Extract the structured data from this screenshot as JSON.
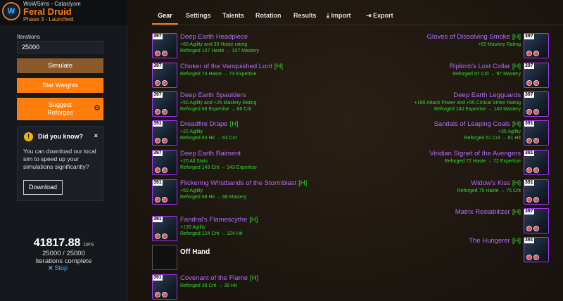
{
  "app": {
    "name": "WoWSims - Cataclysm",
    "spec": "Feral Druid",
    "phase": "Phase 3 - Launched",
    "logo_text": "W"
  },
  "sidebar": {
    "iterations_label": "Iterations",
    "iterations_value": "25000",
    "simulate_label": "Simulate",
    "stat_weights_label": "Stat Weights",
    "suggest_reforges_label": "Suggest Reforges",
    "tip": {
      "title": "Did you know?",
      "body": "You can download our local sim to speed up your simulations significantly?",
      "button": "Download",
      "close": "×",
      "icon": "!"
    },
    "result": {
      "dps": "41817.88",
      "unit": "DPS",
      "progress": "25000 / 25000",
      "complete": "iterations complete",
      "stop": "Stop"
    }
  },
  "tabs": [
    "Gear",
    "Settings",
    "Talents",
    "Rotation",
    "Results",
    "Import",
    "Export"
  ],
  "active_tab": "Gear",
  "gear": {
    "left": [
      {
        "ilvl": "397",
        "name": "Deep Earth Headpiece",
        "heroic": "",
        "stats": "+60 Agility and 35 Haste rating",
        "reforge": "Reforged 107 Haste → 107 Mastery"
      },
      {
        "ilvl": "397",
        "name": "Choker of the Vanquished Lord",
        "heroic": "[H]",
        "stats": "",
        "reforge": "Reforged 73 Haste → 73 Expertise"
      },
      {
        "ilvl": "397",
        "name": "Deep Earth Spaulders",
        "heroic": "",
        "stats": "+50 Agility and +25 Mastery Rating",
        "reforge": "Reforged 68 Expertise → 68 Crit"
      },
      {
        "ilvl": "391",
        "name": "Dreadfire Drape",
        "heroic": "[H]",
        "stats": "+22 Agility",
        "reforge": "Reforged 63 Hit → 63 Crit"
      },
      {
        "ilvl": "397",
        "name": "Deep Earth Raiment",
        "heroic": "",
        "stats": "+20 All Stats",
        "reforge": "Reforged 143 Crit → 143 Expertise"
      },
      {
        "ilvl": "391",
        "name": "Flickering Wristbands of the Stormblast",
        "heroic": "[H]",
        "stats": "+50 Agility",
        "reforge": "Reforged 68 Hit → 68 Mastery"
      },
      {
        "ilvl": "391",
        "name": "Fandral's Flamescythe",
        "heroic": "[H]",
        "stats": "+130 Agility",
        "reforge": "Reforged 124 Crit → 124 Hit"
      },
      {
        "ilvl": "",
        "name": "Off Hand",
        "heroic": "",
        "stats": "",
        "reforge": "",
        "empty": true
      },
      {
        "ilvl": "391",
        "name": "Covenant of the Flame",
        "heroic": "[H]",
        "stats": "",
        "reforge": "Reforged 39 Crit → 39 Hit"
      }
    ],
    "right": [
      {
        "ilvl": "397",
        "name": "Gloves of Dissolving Smoke",
        "heroic": "[H]",
        "stats": "",
        "reforge": "+65 Mastery Rating"
      },
      {
        "ilvl": "397",
        "name": "Riplimb's Lost Collar",
        "heroic": "[H]",
        "stats": "",
        "reforge": "Reforged 97 Crit → 97 Mastery"
      },
      {
        "ilvl": "397",
        "name": "Deep Earth Legguards",
        "heroic": "",
        "stats": "+190 Attack Power and +55 Critical Strike Rating",
        "reforge": "Reforged 140 Expertise → 140 Mastery"
      },
      {
        "ilvl": "391",
        "name": "Sandals of Leaping Coals",
        "heroic": "[H]",
        "stats": "+35 Agility",
        "reforge": "Reforged 61 Crit → 61 Hit"
      },
      {
        "ilvl": "391",
        "name": "Viridian Signet of the Avengers",
        "heroic": "",
        "stats": "",
        "reforge": "Reforged 72 Haste → 72 Expertise"
      },
      {
        "ilvl": "391",
        "name": "Widow's Kiss",
        "heroic": "[H]",
        "stats": "",
        "reforge": "Reforged 75 Haste → 75 Crit"
      },
      {
        "ilvl": "397",
        "name": "Matrix Restabilizer",
        "heroic": "[H]",
        "stats": "",
        "reforge": ""
      },
      {
        "ilvl": "391",
        "name": "The Hungerer",
        "heroic": "[H]",
        "stats": "",
        "reforge": ""
      }
    ]
  },
  "colors": {
    "accent": "#ff7d0a",
    "epic": "#b36cff",
    "green": "#2edc2e",
    "link": "#4db0ff"
  }
}
